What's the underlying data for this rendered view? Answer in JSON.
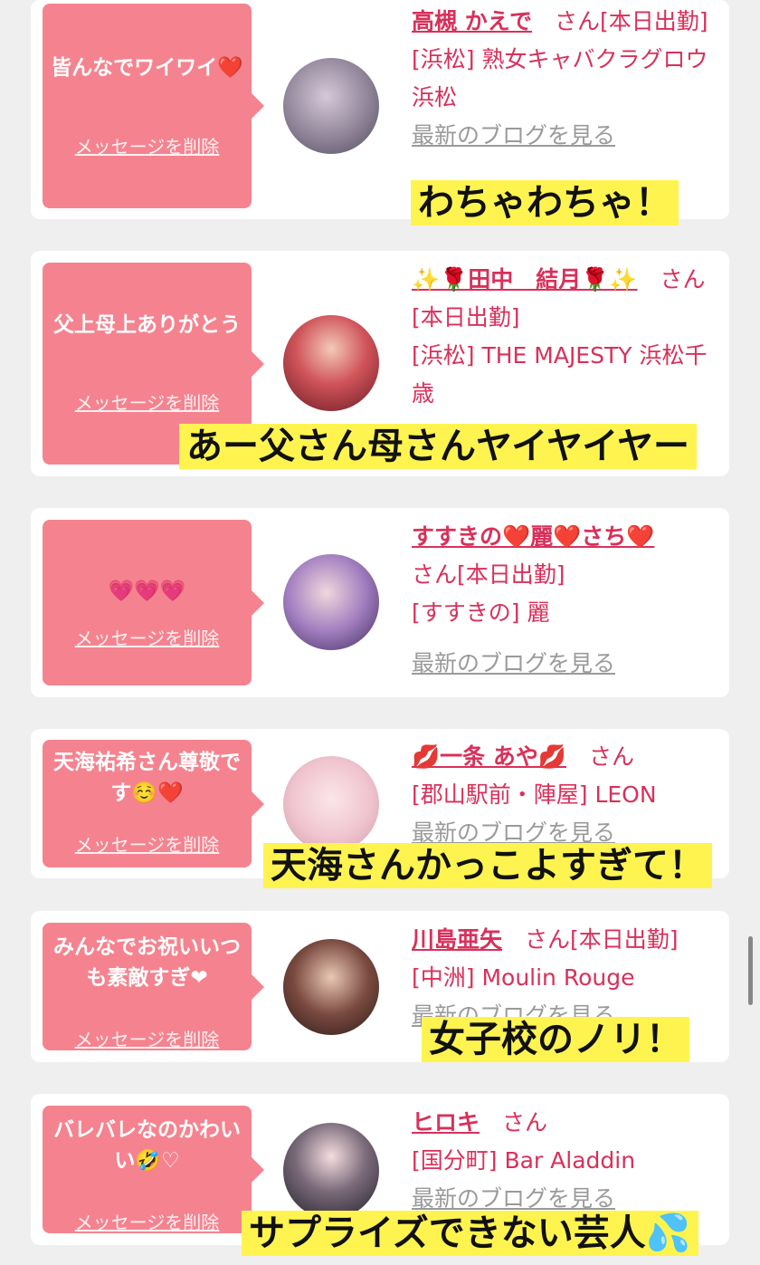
{
  "delete_label": "メッセージを削除",
  "blog_label": "最新のブログを見る",
  "cards": [
    {
      "msg": "皆んなでワイワイ❤️",
      "name": "高槻 かえで",
      "suffix": "さん[本日出勤]",
      "shop": "[浜松] 熟女キャバクラグロウ 浜松",
      "blog": "最新のブログを見る",
      "avatar_color": "#b7a9c4"
    },
    {
      "msg": "父上母上ありがとう",
      "name": "✨🌹田中　結月🌹✨",
      "suffix": "さん[本日出勤]",
      "shop": "[浜松] THE MAJESTY 浜松千歳",
      "blog": "",
      "avatar_color": "#c8454a"
    },
    {
      "msg": "💗💗💗",
      "name": "すすきの❤️麗❤️さち❤️",
      "suffix": "さん[本日出勤]",
      "shop": "[すすきの] 麗",
      "blog": "最新のブログを見る",
      "avatar_color": "#8a6aa8"
    },
    {
      "msg": "天海祐希さん尊敬です☺️❤️",
      "name": "💋一条 あや💋",
      "suffix": "さん",
      "shop": "[郡山駅前・陣屋] LEON",
      "blog": "最新のブログを見る",
      "avatar_color": "#f0cfd8"
    },
    {
      "msg": "みんなでお祝いいつも素敵すぎ❤",
      "name": "川島亜矢",
      "suffix": "さん[本日出勤]",
      "shop": "[中洲] Moulin Rouge",
      "blog": "最新のブログを見る",
      "avatar_color": "#5a3e3a"
    },
    {
      "msg": "バレバレなのかわいい🤣♡",
      "name": "ヒロキ",
      "suffix": "さん",
      "shop": "[国分町] Bar Aladdin",
      "blog": "最新のブログを見る",
      "avatar_color": "#4a4a5a"
    }
  ],
  "captions": [
    "わちゃわちゃ！",
    "あー父さん母さんヤイヤイヤー",
    "天海さんかっこよすぎて！",
    "女子校のノリ！",
    "サプライズできない芸人💦"
  ]
}
